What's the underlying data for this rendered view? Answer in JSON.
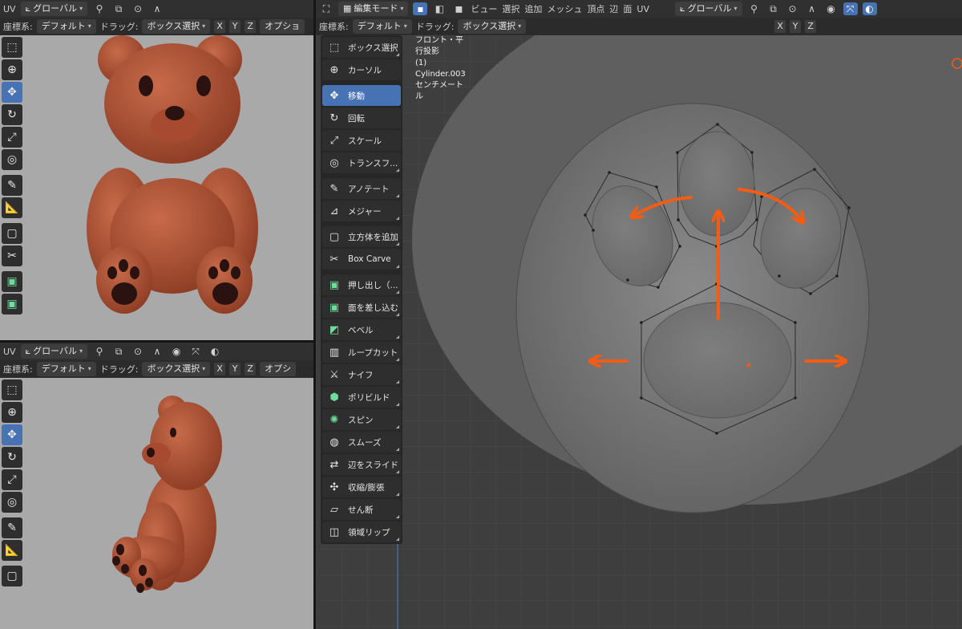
{
  "top_left": {
    "tab_uv": "UV",
    "coord_dropdown": "グローバル",
    "row2_label_coord": "座標系:",
    "row2_coord_value": "デフォルト",
    "row2_label_drag": "ドラッグ:",
    "row2_drag_value": "ボックス選択",
    "axes": [
      "X",
      "Y",
      "Z"
    ],
    "options_button": "オプショ"
  },
  "bottom_left": {
    "tab_uv": "UV",
    "coord_dropdown": "グローバル",
    "row2_label_coord": "座標系:",
    "row2_coord_value": "デフォルト",
    "row2_label_drag": "ドラッグ:",
    "row2_drag_value": "ボックス選択",
    "axes": [
      "X",
      "Y",
      "Z"
    ],
    "options_button": "オプシ"
  },
  "main_header": {
    "mode_dropdown": "編集モード",
    "menus": [
      "ビュー",
      "選択",
      "追加",
      "メッシュ",
      "頂点",
      "辺",
      "面",
      "UV"
    ],
    "coord_dropdown": "グローバル",
    "row2_label_coord": "座標系:",
    "row2_coord_value": "デフォルト",
    "row2_label_drag": "ドラッグ:",
    "row2_drag_value": "ボックス選択",
    "axes": [
      "X",
      "Y",
      "Z"
    ]
  },
  "viewport_info": {
    "view_name": "フロント・平行投影",
    "object_name": "(1) Cylinder.003",
    "units": "センチメートル"
  },
  "toolbar": {
    "tools": [
      {
        "label": "ボックス選択",
        "icon": "box-select-icon"
      },
      {
        "label": "カーソル",
        "icon": "cursor-icon"
      },
      {
        "label": "移動",
        "icon": "move-icon",
        "active": true
      },
      {
        "label": "回転",
        "icon": "rotate-icon"
      },
      {
        "label": "スケール",
        "icon": "scale-icon"
      },
      {
        "label": "トランスフ...",
        "icon": "transform-icon"
      },
      {
        "label": "アノテート",
        "icon": "annotate-icon"
      },
      {
        "label": "メジャー",
        "icon": "measure-icon"
      },
      {
        "label": "立方体を追加",
        "icon": "add-cube-icon"
      },
      {
        "label": "Box Carve",
        "icon": "box-carve-icon"
      },
      {
        "label": "押し出し（...",
        "icon": "extrude-icon"
      },
      {
        "label": "面を差し込む",
        "icon": "inset-icon"
      },
      {
        "label": "ベベル",
        "icon": "bevel-icon"
      },
      {
        "label": "ループカット",
        "icon": "loop-cut-icon"
      },
      {
        "label": "ナイフ",
        "icon": "knife-icon"
      },
      {
        "label": "ポリビルド",
        "icon": "poly-build-icon"
      },
      {
        "label": "スピン",
        "icon": "spin-icon"
      },
      {
        "label": "スムーズ",
        "icon": "smooth-icon"
      },
      {
        "label": "辺をスライド",
        "icon": "edge-slide-icon"
      },
      {
        "label": "収縮/膨張",
        "icon": "shrink-fatten-icon"
      },
      {
        "label": "せん断",
        "icon": "shear-icon"
      },
      {
        "label": "領域リップ",
        "icon": "rip-region-icon"
      }
    ]
  },
  "colors": {
    "accent": "#4772b3",
    "bear": "#b1553a",
    "arrow": "#f25c14",
    "viewport_grey": "#a9a9a9",
    "viewport_dark": "#3e3e3e"
  }
}
